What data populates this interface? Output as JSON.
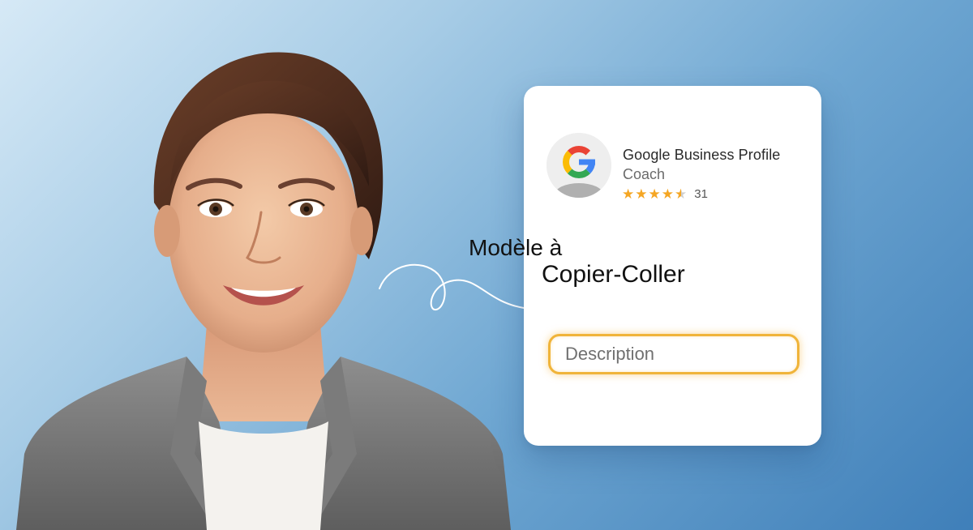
{
  "card": {
    "title": "Google Business Profile",
    "subtitle": "Coach",
    "rating_value": 4.5,
    "rating_count": "31",
    "description_placeholder": "Description"
  },
  "overlay": {
    "line1": "Modèle à",
    "line2": "Copier-Coller"
  },
  "icons": {
    "logo": "google-g-icon",
    "star": "star-icon",
    "curl": "curl-connector"
  },
  "colors": {
    "background_light": "#d6e9f6",
    "background_dark": "#3f7fb9",
    "star": "#f5a623",
    "field_border": "#f0b43a",
    "google_blue": "#4285F4",
    "google_red": "#EA4335",
    "google_yellow": "#FBBC05",
    "google_green": "#34A853"
  }
}
